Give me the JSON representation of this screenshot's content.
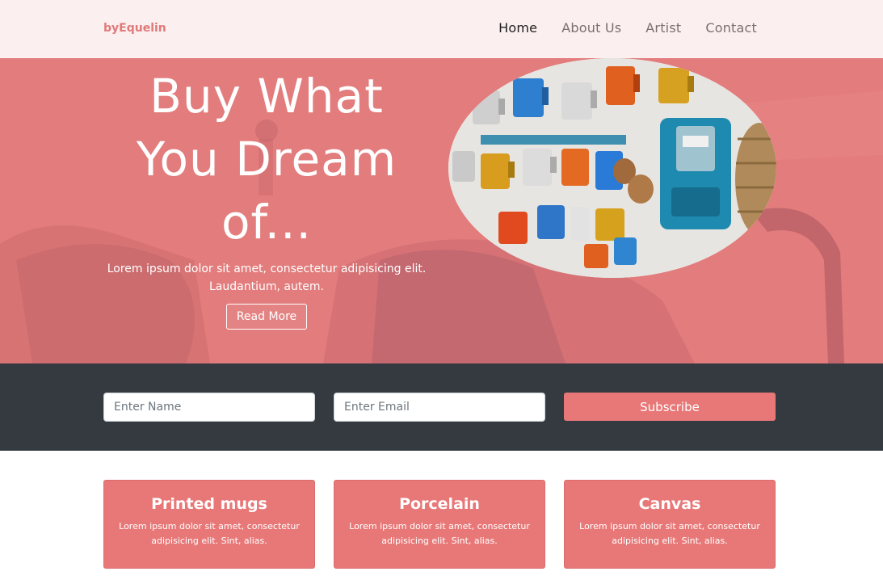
{
  "navbar": {
    "brand": "byEquelin",
    "links": [
      {
        "label": "Home",
        "active": true
      },
      {
        "label": "About Us",
        "active": false
      },
      {
        "label": "Artist",
        "active": false
      },
      {
        "label": "Contact",
        "active": false
      }
    ]
  },
  "hero": {
    "title": "Buy What You Dream of...",
    "subtitle": "Lorem ipsum dolor sit amet, consectetur adipisicing elit. Laudantium, autem.",
    "button_label": "Read More"
  },
  "subscribe": {
    "name_placeholder": "Enter Name",
    "email_placeholder": "Enter Email",
    "button_label": "Subscribe"
  },
  "cards": [
    {
      "title": "Printed mugs",
      "text": "Lorem ipsum dolor sit amet, consectetur adipisicing elit. Sint, alias."
    },
    {
      "title": "Porcelain",
      "text": "Lorem ipsum dolor sit amet, consectetur adipisicing elit. Sint, alias."
    },
    {
      "title": "Canvas",
      "text": "Lorem ipsum dolor sit amet, consectetur adipisicing elit. Sint, alias."
    }
  ],
  "colors": {
    "brand": "#e07a7a",
    "hero_overlay": "#e57f7f",
    "dark_band": "#343a40",
    "accent": "#e87878"
  }
}
